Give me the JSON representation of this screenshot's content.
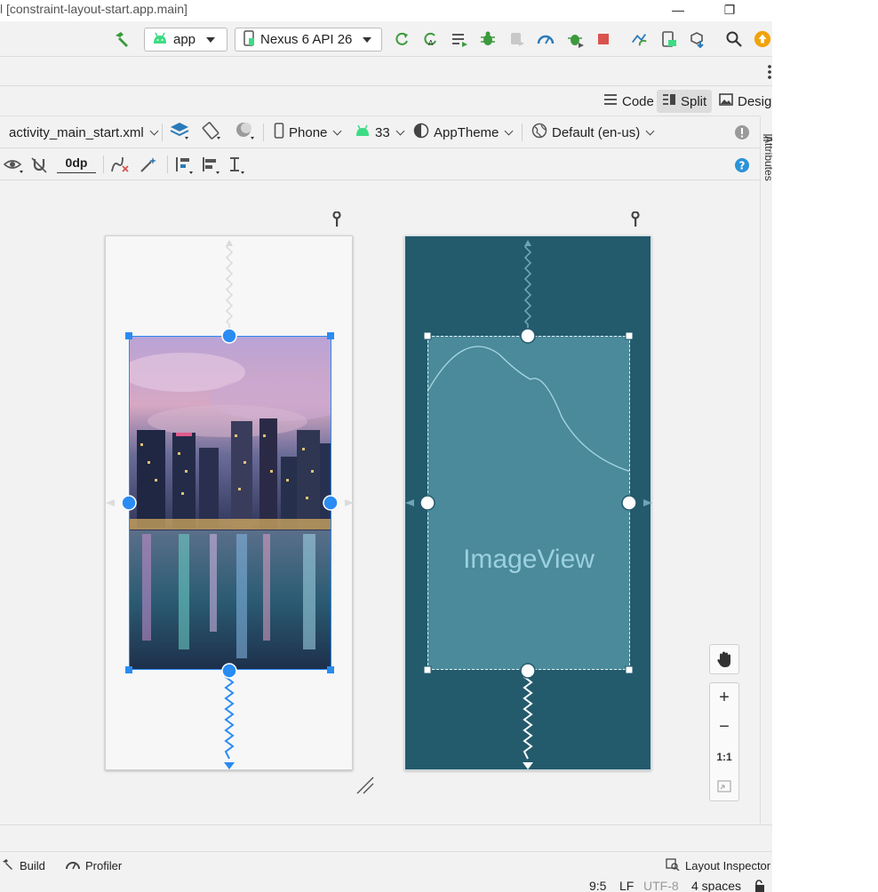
{
  "window": {
    "title": "l [constraint-layout-start.app.main]",
    "minimize_glyph": "—",
    "restore_glyph": "❐"
  },
  "toolbar": {
    "run_config": "app",
    "device": "Nexus 6 API 26",
    "icons": [
      "hammer-icon",
      "android-icon",
      "phone-icon",
      "apply-changes-icon",
      "apply-code-changes-icon",
      "run-list-icon",
      "debug-icon",
      "attach-icon",
      "profile-icon",
      "debug-attach-icon",
      "stop-icon",
      "sync-icon",
      "avd-manager-icon",
      "sdk-manager-icon",
      "search-icon",
      "update-icon"
    ]
  },
  "editor_modes": {
    "code": "Code",
    "split": "Split",
    "design": "Design",
    "active": "Split"
  },
  "design_toolbar": {
    "file": "activity_main_start.xml",
    "device_type": "Phone",
    "api_level": "33",
    "theme": "AppTheme",
    "locale": "Default (en-us)"
  },
  "layout_toolbar": {
    "default_margin": "0dp"
  },
  "side_panel": {
    "label": "Attributes"
  },
  "blueprint": {
    "view_label": "ImageView"
  },
  "zoom": {
    "zoom_in": "+",
    "zoom_out": "−",
    "actual_size": "1:1"
  },
  "tool_windows": {
    "build": "Build",
    "profiler": "Profiler",
    "layout_inspector": "Layout Inspector"
  },
  "status": {
    "position": "9:5",
    "line_sep": "LF",
    "encoding": "UTF-8",
    "indent": "4 spaces"
  },
  "colors": {
    "selection_blue": "#2a8bf2",
    "blueprint_bg": "#235a6c",
    "blueprint_view": "#4a8a9a",
    "stop_red": "#d9534f",
    "android_green": "#3ddc84"
  }
}
